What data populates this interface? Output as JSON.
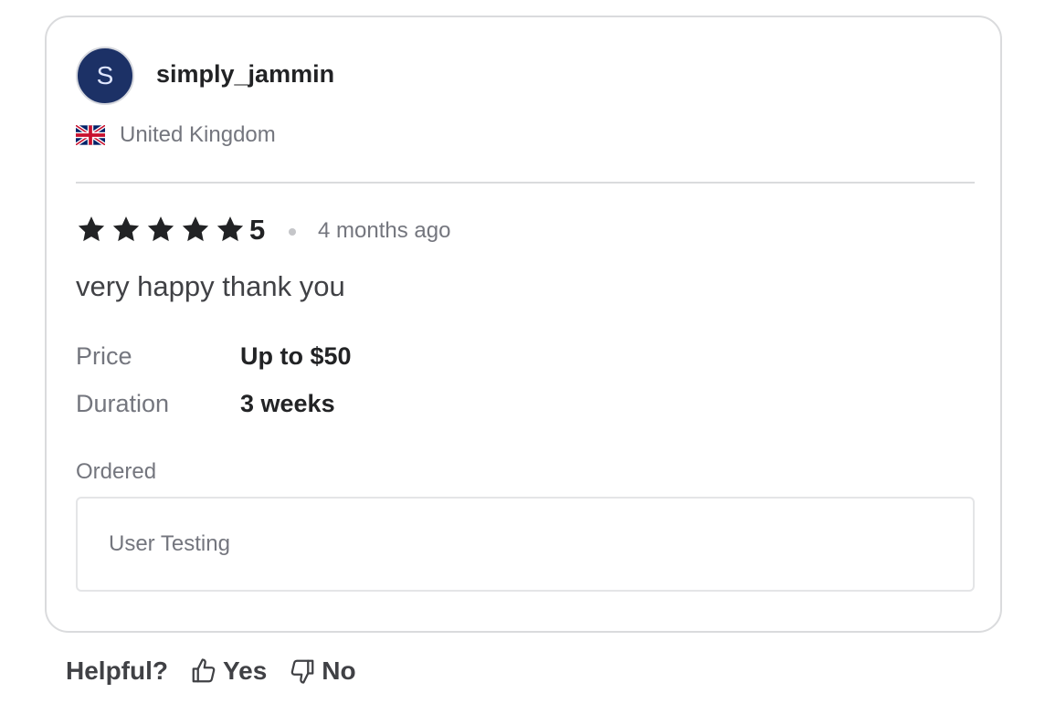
{
  "reviewer": {
    "avatar_initial": "S",
    "username": "simply_jammin",
    "country": "United Kingdom",
    "flag_icon": "uk-flag-icon"
  },
  "review": {
    "stars": 5,
    "rating": "5",
    "time_ago": "4 months ago",
    "text": "very happy thank you"
  },
  "details": [
    {
      "label": "Price",
      "value": "Up to $50"
    },
    {
      "label": "Duration",
      "value": "3 weeks"
    }
  ],
  "ordered": {
    "label": "Ordered",
    "item": "User Testing"
  },
  "helpful": {
    "label": "Helpful?",
    "yes_label": "Yes",
    "no_label": "No",
    "yes_icon": "thumbs-up-icon",
    "no_icon": "thumbs-down-icon"
  },
  "colors": {
    "avatar_bg": "#1c3166",
    "text_primary": "#222325",
    "text_secondary": "#74767e",
    "border": "#dadbdd"
  }
}
